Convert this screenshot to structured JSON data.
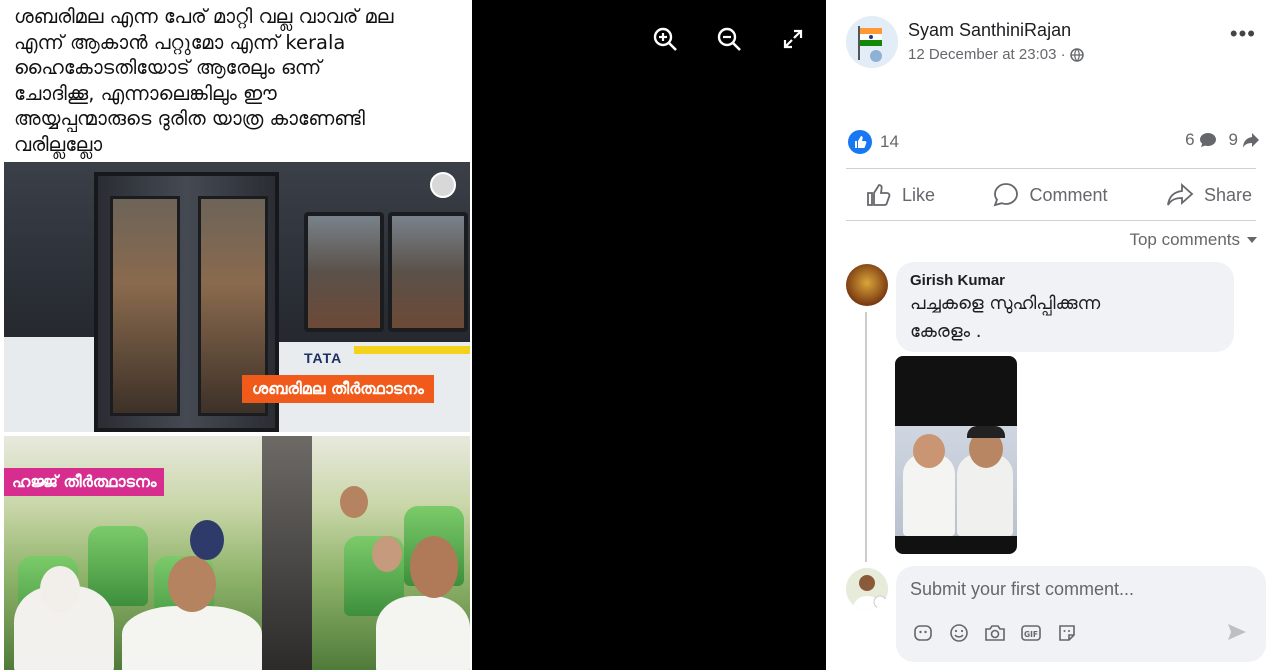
{
  "post_image": {
    "caption_lines": [
      "ശബരിമല എന്ന പേര് മാറ്റി വല്ല വാവര് മല",
      "എന്ന് ആകാൻ പറ്റുമോ എന്ന്  kerala",
      "ഹൈകോടതിയോട് ആരേലും ഒന്ന്",
      "ചോദിക്കൂ, എന്നാലെങ്കിലും ഈ",
      "അയ്യപ്പന്മാരുടെ ദുരിത യാത്ര കാണേണ്ടി",
      "വരില്ലല്ലോ"
    ],
    "bus_tag": "ശബരിമല തീർത്ഥാടനം",
    "bus_brand": "TATA",
    "plane_tag": "ഹജ്ജ് തീർത്ഥാടനം"
  },
  "viewer_tools": {
    "zoom_in": "zoom-in-icon",
    "zoom_out": "zoom-out-icon",
    "fullscreen": "expand-icon"
  },
  "post": {
    "author": "Syam SanthiniRajan",
    "timestamp": "12 December at 23:03 ·",
    "likes": "14",
    "comments_count": "6",
    "shares_count": "9",
    "actions": {
      "like": "Like",
      "comment": "Comment",
      "share": "Share"
    },
    "sort_label": "Top comments"
  },
  "comment": {
    "author": "Girish Kumar",
    "text_line1": "പച്ചകളെ സുഹിപ്പിക്കുന്ന",
    "text_line2": "കേരളം ."
  },
  "composer": {
    "placeholder": "Submit your first comment..."
  },
  "colors": {
    "accent": "#1877f2",
    "orange_tag": "#f05a1a",
    "pink_tag": "#d62d8f"
  }
}
